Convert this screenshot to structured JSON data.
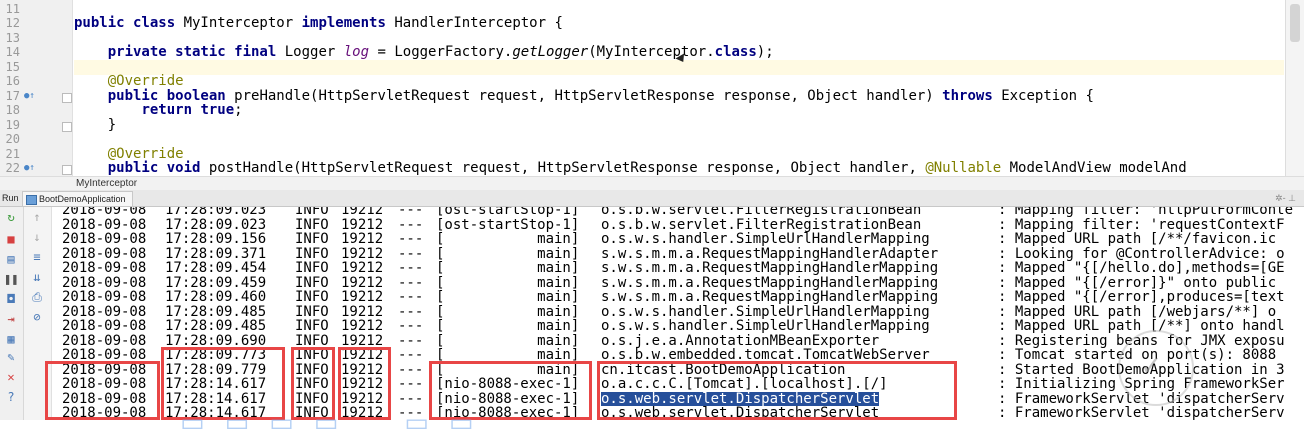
{
  "editor": {
    "line_numbers": [
      "11",
      "12",
      "13",
      "14",
      "15",
      "16",
      "17",
      "18",
      "19",
      "20",
      "21",
      "22"
    ],
    "breadcrumb": "MyInterceptor"
  },
  "run_panel": {
    "label": "Run",
    "tab_label": "BootDemoApplication"
  },
  "console": {
    "lines": [
      {
        "date": "2018-09-08",
        "time": "17:28:09.023",
        "level": "INFO",
        "pid": "19212",
        "dash": "---",
        "thread": "[ost-startStop-1]",
        "logger": "o.s.b.w.servlet.FilterRegistrationBean",
        "msg": ": Mapping filter: 'httpPutFormConte"
      },
      {
        "date": "2018-09-08",
        "time": "17:28:09.023",
        "level": "INFO",
        "pid": "19212",
        "dash": "---",
        "thread": "[ost-startStop-1]",
        "logger": "o.s.b.w.servlet.FilterRegistrationBean",
        "msg": ": Mapping filter: 'requestContextF"
      },
      {
        "date": "2018-09-08",
        "time": "17:28:09.156",
        "level": "INFO",
        "pid": "19212",
        "dash": "---",
        "thread": "[           main]",
        "logger": "o.s.w.s.handler.SimpleUrlHandlerMapping",
        "msg": ": Mapped URL path [/**/favicon.ic"
      },
      {
        "date": "2018-09-08",
        "time": "17:28:09.371",
        "level": "INFO",
        "pid": "19212",
        "dash": "---",
        "thread": "[           main]",
        "logger": "s.w.s.m.m.a.RequestMappingHandlerAdapter",
        "msg": ": Looking for @ControllerAdvice: o"
      },
      {
        "date": "2018-09-08",
        "time": "17:28:09.454",
        "level": "INFO",
        "pid": "19212",
        "dash": "---",
        "thread": "[           main]",
        "logger": "s.w.s.m.m.a.RequestMappingHandlerMapping",
        "msg": ": Mapped \"{[/hello.do],methods=[GE"
      },
      {
        "date": "2018-09-08",
        "time": "17:28:09.459",
        "level": "INFO",
        "pid": "19212",
        "dash": "---",
        "thread": "[           main]",
        "logger": "s.w.s.m.m.a.RequestMappingHandlerMapping",
        "msg": ": Mapped \"{[/error]}\" onto public"
      },
      {
        "date": "2018-09-08",
        "time": "17:28:09.460",
        "level": "INFO",
        "pid": "19212",
        "dash": "---",
        "thread": "[           main]",
        "logger": "s.w.s.m.m.a.RequestMappingHandlerMapping",
        "msg": ": Mapped \"{[/error],produces=[text"
      },
      {
        "date": "2018-09-08",
        "time": "17:28:09.485",
        "level": "INFO",
        "pid": "19212",
        "dash": "---",
        "thread": "[           main]",
        "logger": "o.s.w.s.handler.SimpleUrlHandlerMapping",
        "msg": ": Mapped URL path [/webjars/**] o"
      },
      {
        "date": "2018-09-08",
        "time": "17:28:09.485",
        "level": "INFO",
        "pid": "19212",
        "dash": "---",
        "thread": "[           main]",
        "logger": "o.s.w.s.handler.SimpleUrlHandlerMapping",
        "msg": ": Mapped URL path [/**] onto handl"
      },
      {
        "date": "2018-09-08",
        "time": "17:28:09.690",
        "level": "INFO",
        "pid": "19212",
        "dash": "---",
        "thread": "[           main]",
        "logger": "o.s.j.e.a.AnnotationMBeanExporter",
        "msg": ": Registering beans for JMX exposu"
      },
      {
        "date": "2018-09-08",
        "time": "17:28:09.773",
        "level": "INFO",
        "pid": "19212",
        "dash": "---",
        "thread": "[           main]",
        "logger": "o.s.b.w.embedded.tomcat.TomcatWebServer",
        "msg": ": Tomcat started on port(s): 8088"
      },
      {
        "date": "2018-09-08",
        "time": "17:28:09.779",
        "level": "INFO",
        "pid": "19212",
        "dash": "---",
        "thread": "[           main]",
        "logger": "cn.itcast.BootDemoApplication",
        "msg": ": Started BootDemoApplication in 3"
      },
      {
        "date": "2018-09-08",
        "time": "17:28:14.617",
        "level": "INFO",
        "pid": "19212",
        "dash": "---",
        "thread": "[nio-8088-exec-1]",
        "logger": "o.a.c.c.C.[Tomcat].[localhost].[/]",
        "msg": ": Initializing Spring FrameworkSer"
      },
      {
        "date": "2018-09-08",
        "time": "17:28:14.617",
        "level": "INFO",
        "pid": "19212",
        "dash": "---",
        "thread": "[nio-8088-exec-1]",
        "logger": "o.s.web.servlet.DispatcherServlet",
        "msg": ": FrameworkServlet 'dispatcherServ"
      },
      {
        "date": "2018-09-08",
        "time": "17:28:14.617",
        "level": "INFO",
        "pid": "19212",
        "dash": "---",
        "thread": "[nio-8088-exec-1]",
        "logger": "o.s.web.servlet.DispatcherServlet",
        "msg": ": FrameworkServlet 'dispatcherServ"
      }
    ]
  },
  "colors": {
    "keyword": "#000080",
    "annotation": "#808000",
    "field": "#660e7a",
    "highlight_box": "#e84646",
    "selection": "#264f9a",
    "current_line": "#fffae3"
  },
  "icons": [
    "rerun-icon",
    "stop-icon",
    "restore-layout-icon",
    "pause-icon",
    "dump-threads-icon",
    "camera-icon",
    "exit-icon",
    "settings-icon",
    "pin-icon",
    "close-icon",
    "help-icon",
    "up-arrow-icon",
    "down-arrow-icon",
    "soft-wrap-icon",
    "scroll-to-end-icon",
    "print-icon",
    "clear-icon",
    "gear-icon",
    "minimize-icon"
  ]
}
